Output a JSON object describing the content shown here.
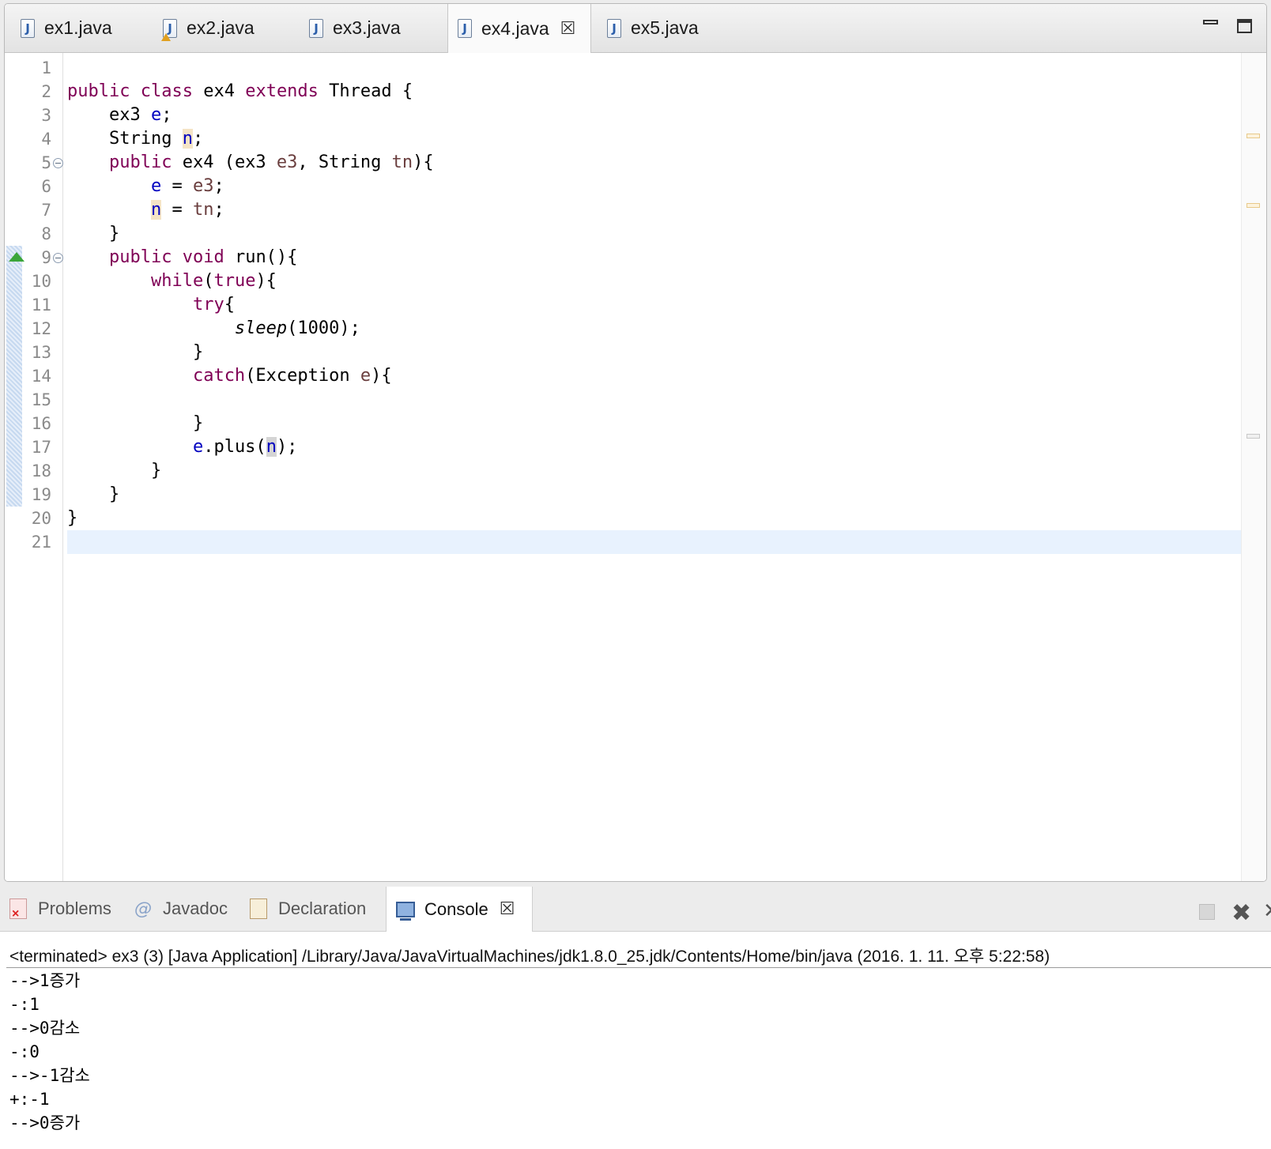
{
  "editor_tabs": [
    {
      "label": "ex1.java",
      "icon": "java-file-icon",
      "active": false,
      "warning": false
    },
    {
      "label": "ex2.java",
      "icon": "java-file-warning-icon",
      "active": false,
      "warning": true
    },
    {
      "label": "ex3.java",
      "icon": "java-file-icon",
      "active": false,
      "warning": false
    },
    {
      "label": "ex4.java",
      "icon": "java-file-icon",
      "active": true,
      "warning": false,
      "close_glyph": "☒"
    },
    {
      "label": "ex5.java",
      "icon": "java-file-icon",
      "active": false,
      "warning": false
    }
  ],
  "window_controls": {
    "minimize": "minimize-icon",
    "maximize": "maximize-icon"
  },
  "line_numbers": [
    "1",
    "2",
    "3",
    "4",
    "5",
    "6",
    "7",
    "8",
    "9",
    "10",
    "11",
    "12",
    "13",
    "14",
    "15",
    "16",
    "17",
    "18",
    "19",
    "20",
    "21"
  ],
  "current_line": 21,
  "code_lines": [
    [],
    [
      [
        "kw",
        "public"
      ],
      [
        "",
        " "
      ],
      [
        "kw",
        "class"
      ],
      [
        "",
        " ex4 "
      ],
      [
        "kw",
        "extends"
      ],
      [
        "",
        " Thread {"
      ]
    ],
    [
      [
        "",
        "    ex3 "
      ],
      [
        "fld",
        "e"
      ],
      [
        "",
        ";"
      ]
    ],
    [
      [
        "",
        "    String "
      ],
      [
        "fld hl-occ",
        "n"
      ],
      [
        "",
        ";"
      ]
    ],
    [
      [
        "",
        "    "
      ],
      [
        "kw",
        "public"
      ],
      [
        "",
        ""
      ],
      [
        "",
        " ex4 (ex3 "
      ],
      [
        "prm",
        "e3"
      ],
      [
        "",
        ", String "
      ],
      [
        "prm",
        "tn"
      ],
      [
        "",
        "){"
      ]
    ],
    [
      [
        "",
        "        "
      ],
      [
        "fld",
        "e"
      ],
      [
        "",
        " = "
      ],
      [
        "prm",
        "e3"
      ],
      [
        "",
        ";"
      ]
    ],
    [
      [
        "",
        "        "
      ],
      [
        "fld hl-occ",
        "n"
      ],
      [
        "",
        " = "
      ],
      [
        "prm",
        "tn"
      ],
      [
        "",
        ";"
      ]
    ],
    [
      [
        "",
        "    }"
      ]
    ],
    [
      [
        "",
        "    "
      ],
      [
        "kw",
        "public"
      ],
      [
        "",
        " "
      ],
      [
        "kw",
        "void"
      ],
      [
        "",
        " run(){"
      ]
    ],
    [
      [
        "",
        "        "
      ],
      [
        "kw",
        "while"
      ],
      [
        "",
        "("
      ],
      [
        "kw",
        "true"
      ],
      [
        "",
        "){"
      ]
    ],
    [
      [
        "",
        "            "
      ],
      [
        "kw",
        "try"
      ],
      [
        "",
        "{"
      ]
    ],
    [
      [
        "",
        "                "
      ],
      [
        "it",
        "sleep"
      ],
      [
        "",
        "(1000);"
      ]
    ],
    [
      [
        "",
        "            }"
      ]
    ],
    [
      [
        "",
        "            "
      ],
      [
        "kw",
        "catch"
      ],
      [
        "",
        "(Exception "
      ],
      [
        "prm",
        "e"
      ],
      [
        "",
        "){"
      ]
    ],
    [],
    [
      [
        "",
        "            }"
      ]
    ],
    [
      [
        "",
        "            "
      ],
      [
        "fld",
        "e"
      ],
      [
        "",
        ".plus("
      ],
      [
        "fld hl-sel",
        "n"
      ],
      [
        "",
        ");"
      ]
    ],
    [
      [
        "",
        "        }"
      ]
    ],
    [
      [
        "",
        "    }"
      ]
    ],
    [
      [
        "",
        "}"
      ]
    ],
    []
  ],
  "gutter_markers": {
    "folds": [
      5,
      9
    ],
    "override": 9,
    "change_range": [
      9,
      19
    ]
  },
  "view_tabs": [
    {
      "label": "Problems",
      "icon": "problems-icon",
      "active": false
    },
    {
      "label": "Javadoc",
      "icon": "javadoc-icon",
      "glyph": "@",
      "active": false
    },
    {
      "label": "Declaration",
      "icon": "declaration-icon",
      "active": false
    },
    {
      "label": "Console",
      "icon": "console-icon",
      "active": true,
      "close_glyph": "☒"
    }
  ],
  "console": {
    "header": "<terminated> ex3 (3) [Java Application] /Library/Java/JavaVirtualMachines/jdk1.8.0_25.jdk/Contents/Home/bin/java (2016. 1. 11. 오후 5:22:58)",
    "output": [
      "-->1증가",
      "-:1",
      "-->0감소",
      "-:0",
      "-->-1감소",
      "+:-1",
      "-->0증가"
    ]
  },
  "colors": {
    "keyword": "#7f0055",
    "field": "#0000c0",
    "param": "#6a3e3e",
    "current_line": "#e8f2fe",
    "override_marker": "#3aa53a"
  }
}
